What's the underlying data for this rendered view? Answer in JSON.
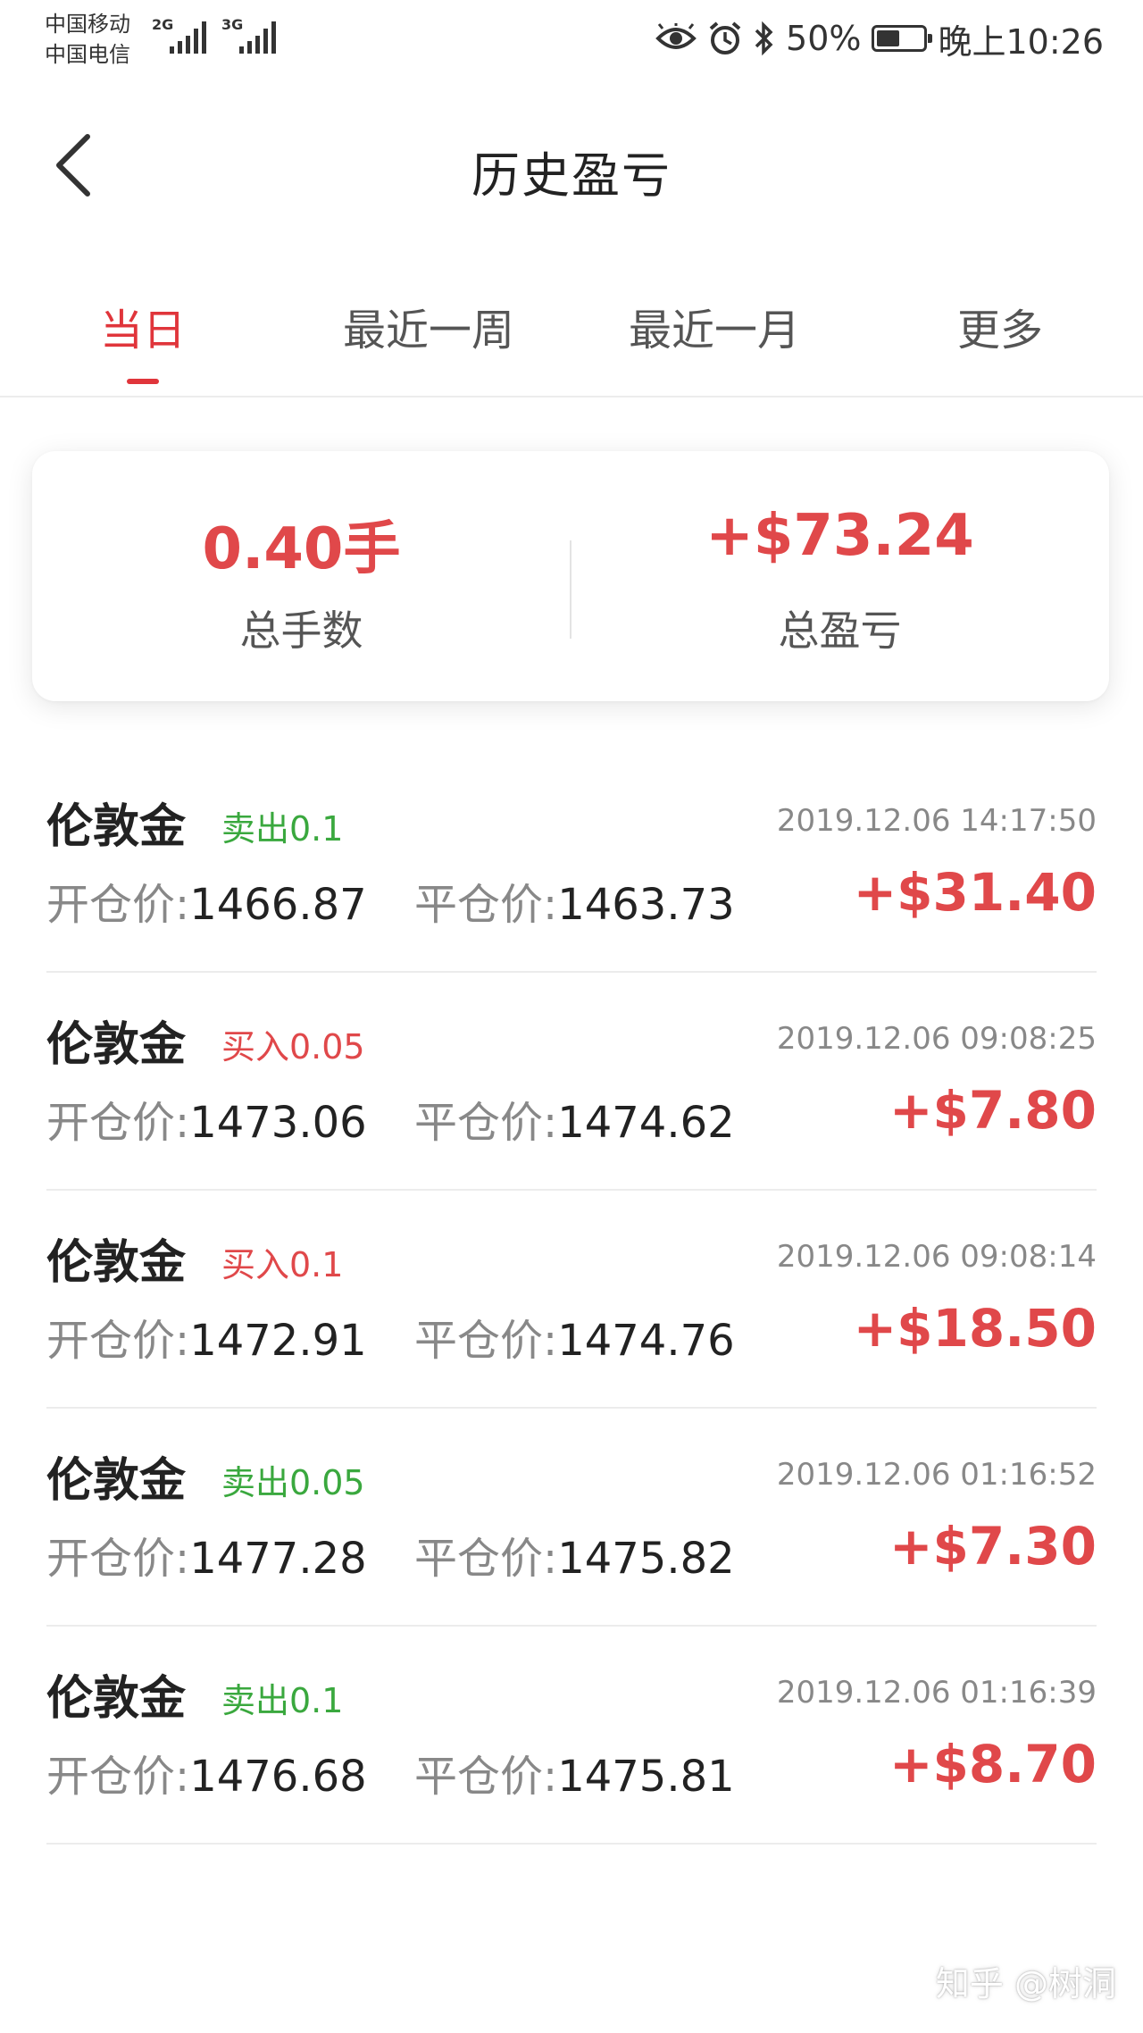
{
  "status_bar": {
    "carrier1": "中国移动",
    "carrier2": "中国电信",
    "net1": "2G",
    "net2": "3G",
    "battery_text": "50%",
    "battery_level": 0.5,
    "time": "晚上10:26",
    "icons": [
      "eye-icon",
      "alarm-icon",
      "bluetooth-icon",
      "battery-icon"
    ]
  },
  "nav": {
    "title": "历史盈亏",
    "back_icon": "chevron-left-icon"
  },
  "tabs": [
    {
      "label": "当日",
      "active": true
    },
    {
      "label": "最近一周",
      "active": false
    },
    {
      "label": "最近一月",
      "active": false
    },
    {
      "label": "更多",
      "active": false
    }
  ],
  "summary": {
    "lots_value": "0.40手",
    "lots_label": "总手数",
    "pnl_value": "+$73.24",
    "pnl_label": "总盈亏"
  },
  "trades": [
    {
      "name": "伦敦金",
      "direction": "卖出0.1",
      "side": "sell",
      "time": "2019.12.06 14:17:50",
      "open_label": "开仓价:",
      "open_price": "1466.87",
      "close_label": "平仓价:",
      "close_price": "1463.73",
      "pnl": "+$31.40"
    },
    {
      "name": "伦敦金",
      "direction": "买入0.05",
      "side": "buy",
      "time": "2019.12.06 09:08:25",
      "open_label": "开仓价:",
      "open_price": "1473.06",
      "close_label": "平仓价:",
      "close_price": "1474.62",
      "pnl": "+$7.80"
    },
    {
      "name": "伦敦金",
      "direction": "买入0.1",
      "side": "buy",
      "time": "2019.12.06 09:08:14",
      "open_label": "开仓价:",
      "open_price": "1472.91",
      "close_label": "平仓价:",
      "close_price": "1474.76",
      "pnl": "+$18.50"
    },
    {
      "name": "伦敦金",
      "direction": "卖出0.05",
      "side": "sell",
      "time": "2019.12.06 01:16:52",
      "open_label": "开仓价:",
      "open_price": "1477.28",
      "close_label": "平仓价:",
      "close_price": "1475.82",
      "pnl": "+$7.30"
    },
    {
      "name": "伦敦金",
      "direction": "卖出0.1",
      "side": "sell",
      "time": "2019.12.06 01:16:39",
      "open_label": "开仓价:",
      "open_price": "1476.68",
      "close_label": "平仓价:",
      "close_price": "1475.81",
      "pnl": "+$8.70"
    }
  ],
  "watermark": "知乎 @树洞",
  "colors": {
    "accent_red": "#e0353b",
    "profit_red": "#e0484a",
    "sell_green": "#3aa83e",
    "muted_gray": "#888888"
  }
}
